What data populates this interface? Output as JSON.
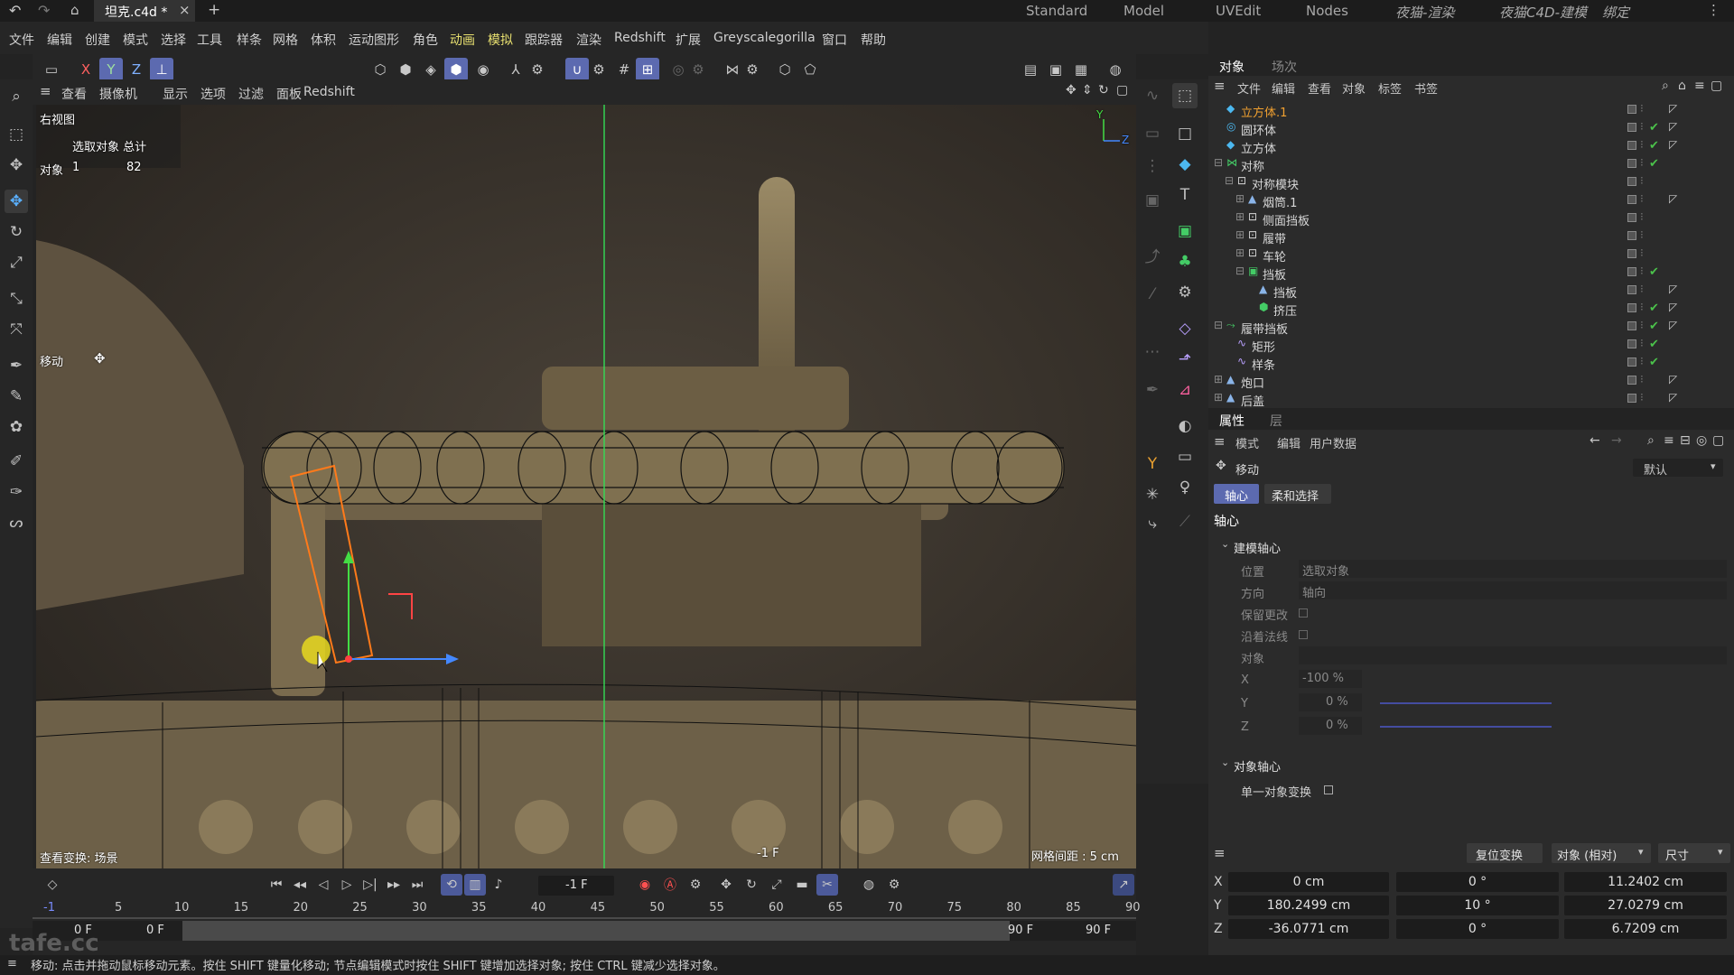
{
  "tabs": {
    "file_name": "坦克.c4d *",
    "close": "×",
    "add": "+"
  },
  "layouts": [
    "Standard",
    "Model",
    "UVEdit",
    "Nodes",
    "夜猫-渲染",
    "夜猫C4D-建模",
    "绑定"
  ],
  "menu": [
    "文件",
    "编辑",
    "创建",
    "模式",
    "选择",
    "工具",
    "样条",
    "网格",
    "体积",
    "运动图形",
    "角色",
    "动画",
    "模拟",
    "跟踪器",
    "渲染",
    "Redshift",
    "扩展",
    "Greyscalegorilla",
    "窗口",
    "帮助"
  ],
  "axis_toolbar": {
    "x": "X",
    "y": "Y",
    "z": "Z"
  },
  "viewport_menu": [
    "查看",
    "摄像机",
    "显示",
    "选项",
    "过滤",
    "面板",
    "Redshift"
  ],
  "viewport": {
    "view_name": "右视图",
    "stats_header": "选取对象  总计",
    "stats_label": "对象",
    "stats_selected": "1",
    "stats_total": "82",
    "tool_name": "移动",
    "view_transform": "查看变换: 场景",
    "frame_label": "-1 F",
    "grid_spacing": "网格间距 : 5 cm",
    "axis_y": "Y",
    "axis_z": "Z"
  },
  "object_panel": {
    "tabs": [
      "对象",
      "场次"
    ],
    "menu": [
      "文件",
      "编辑",
      "查看",
      "对象",
      "标签",
      "书签"
    ],
    "rows": [
      {
        "name": "立方体.1",
        "indent": 0,
        "icon": "cube-icon",
        "color": "#f0a030",
        "check": false
      },
      {
        "name": "圆环体",
        "indent": 0,
        "icon": "torus-icon",
        "color": "#d8d8d8",
        "check": true
      },
      {
        "name": "立方体",
        "indent": 0,
        "icon": "cube-icon",
        "color": "#d8d8d8",
        "check": true
      },
      {
        "name": "对称",
        "indent": 0,
        "icon": "symmetry-icon",
        "color": "#d8d8d8",
        "check": true
      },
      {
        "name": "对称模块",
        "indent": 1,
        "icon": "null-icon",
        "color": "#d8d8d8",
        "check": false
      },
      {
        "name": "烟筒.1",
        "indent": 2,
        "icon": "mesh-icon",
        "color": "#d8d8d8",
        "check": false
      },
      {
        "name": "侧面挡板",
        "indent": 2,
        "icon": "null-icon",
        "color": "#d8d8d8",
        "check": false
      },
      {
        "name": "履带",
        "indent": 2,
        "icon": "null-icon",
        "color": "#d8d8d8",
        "check": false
      },
      {
        "name": "车轮",
        "indent": 2,
        "icon": "null-icon",
        "color": "#d8d8d8",
        "check": false
      },
      {
        "name": "挡板",
        "indent": 2,
        "icon": "group-icon",
        "color": "#d8d8d8",
        "check": true
      },
      {
        "name": "挡板",
        "indent": 3,
        "icon": "mesh-icon",
        "color": "#d8d8d8",
        "check": false
      },
      {
        "name": "挤压",
        "indent": 3,
        "icon": "extrude-icon",
        "color": "#d8d8d8",
        "check": true
      },
      {
        "name": "履带挡板",
        "indent": 0,
        "icon": "sweep-icon",
        "color": "#d8d8d8",
        "check": true
      },
      {
        "name": "矩形",
        "indent": 1,
        "icon": "spline-icon",
        "color": "#d8d8d8",
        "check": true
      },
      {
        "name": "样条",
        "indent": 1,
        "icon": "spline-icon",
        "color": "#d8d8d8",
        "check": true
      },
      {
        "name": "炮口",
        "indent": 0,
        "icon": "mesh-icon",
        "color": "#d8d8d8",
        "check": false
      },
      {
        "name": "后盖",
        "indent": 0,
        "icon": "mesh-icon",
        "color": "#d8d8d8",
        "check": false
      }
    ]
  },
  "attributes": {
    "tabs": [
      "属性",
      "层"
    ],
    "menu": [
      "模式",
      "编辑",
      "用户数据"
    ],
    "tool": "移动",
    "preset": "默认",
    "subtabs": [
      "轴心",
      "柔和选择"
    ],
    "section": "轴心",
    "group1": "建模轴心",
    "position_label": "位置",
    "position_value": "选取对象",
    "direction_label": "方向",
    "direction_value": "轴向",
    "keep_changes": "保留更改",
    "along_normal": "沿着法线",
    "object_label": "对象",
    "x_label": "X",
    "x_value": "-100 %",
    "y_label": "Y",
    "y_value": "0 %",
    "z_label": "Z",
    "z_value": "0 %",
    "group2": "对象轴心",
    "single_object": "单一对象变换"
  },
  "coords": {
    "reset": "复位变换",
    "mode": "对象 (相对)",
    "size_mode": "尺寸",
    "rows": [
      {
        "axis": "X",
        "pos": "0 cm",
        "rot": "0 °",
        "size": "11.2402 cm"
      },
      {
        "axis": "Y",
        "pos": "180.2499 cm",
        "rot": "10 °",
        "size": "27.0279 cm"
      },
      {
        "axis": "Z",
        "pos": "-36.0771 cm",
        "rot": "0 °",
        "size": "6.7209 cm"
      }
    ]
  },
  "timeline": {
    "current_frame": "-1 F",
    "ticks": [
      "-1",
      "5",
      "10",
      "15",
      "20",
      "25",
      "30",
      "35",
      "40",
      "45",
      "50",
      "55",
      "60",
      "65",
      "70",
      "75",
      "80",
      "85",
      "90"
    ],
    "start_a": "0 F",
    "start_b": "0 F",
    "end_a": "90 F",
    "end_b": "90 F"
  },
  "status": {
    "text": "移动: 点击并拖动鼠标移动元素。按住 SHIFT 键量化移动; 节点编辑模式时按住 SHIFT 键增加选择对象; 按住 CTRL 键减少选择对象。"
  },
  "watermark": "tafe.cc"
}
